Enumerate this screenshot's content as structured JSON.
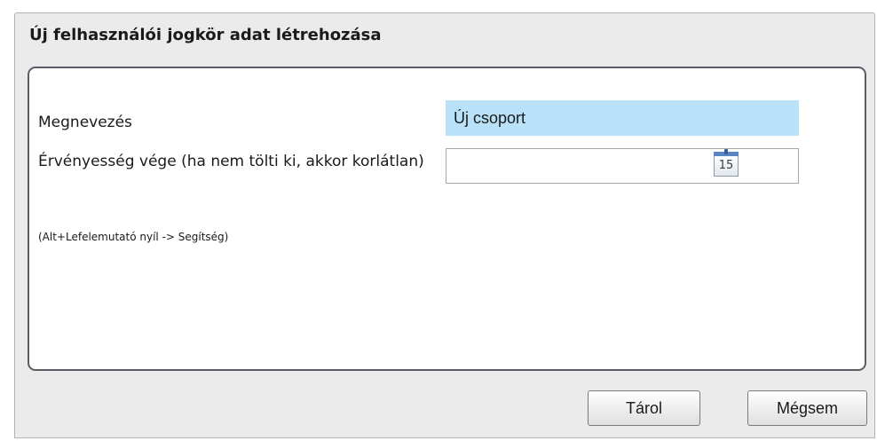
{
  "dialog": {
    "title": "Új felhasználói jogkör adat létrehozása"
  },
  "form": {
    "name_label": "Megnevezés",
    "name_value": "Új csoport",
    "validity_label": "Érvényesség vége (ha nem tölti ki, akkor korlátlan)",
    "validity_value": "",
    "calendar_day": "15",
    "hint": "(Alt+Lefelemutató nyíl -> Segítség)"
  },
  "buttons": {
    "save_label": "Tárol",
    "cancel_label": "Mégsem"
  },
  "colors": {
    "name_field_background": "#b9e2f9",
    "dialog_background": "#ebebeb",
    "panel_border": "#5a5f66"
  },
  "icons": {
    "date_picker": "calendar-icon"
  }
}
